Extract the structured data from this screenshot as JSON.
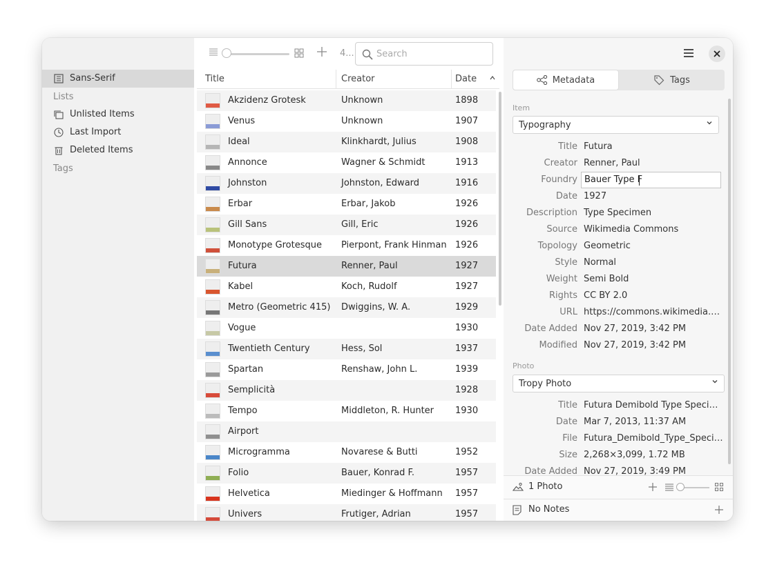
{
  "sidebar": {
    "project": "Sans-Serif",
    "lists_heading": "Lists",
    "items": [
      {
        "label": "Unlisted Items"
      },
      {
        "label": "Last Import"
      },
      {
        "label": "Deleted Items"
      }
    ],
    "tags_heading": "Tags"
  },
  "toolbar": {
    "count": "4...",
    "search_placeholder": "Search"
  },
  "table": {
    "headers": {
      "title": "Title",
      "creator": "Creator",
      "date": "Date"
    },
    "rows": [
      {
        "title": "Akzidenz Grotesk",
        "creator": "Unknown",
        "date": "1898",
        "color": "#e05a44"
      },
      {
        "title": "Venus",
        "creator": "Unknown",
        "date": "1907",
        "color": "#8a9bd6"
      },
      {
        "title": "Ideal",
        "creator": "Klinkhardt, Julius",
        "date": "1908",
        "color": "#b5b5b5"
      },
      {
        "title": "Annonce",
        "creator": "Wagner & Schmidt",
        "date": "1913",
        "color": "#888888"
      },
      {
        "title": "Johnston",
        "creator": "Johnston, Edward",
        "date": "1916",
        "color": "#2f4aa3"
      },
      {
        "title": "Erbar",
        "creator": "Erbar, Jakob",
        "date": "1926",
        "color": "#c98a4b"
      },
      {
        "title": "Gill Sans",
        "creator": "Gill, Eric",
        "date": "1926",
        "color": "#b9c27a"
      },
      {
        "title": "Monotype Grotesque",
        "creator": "Pierpont, Frank Hinman",
        "date": "1926",
        "color": "#d0503a"
      },
      {
        "title": "Futura",
        "creator": "Renner, Paul",
        "date": "1927",
        "color": "#c8b07a"
      },
      {
        "title": "Kabel",
        "creator": "Koch, Rudolf",
        "date": "1927",
        "color": "#d9562f"
      },
      {
        "title": "Metro (Geometric 415)",
        "creator": "Dwiggins, W. A.",
        "date": "1929",
        "color": "#777777"
      },
      {
        "title": "Vogue",
        "creator": "",
        "date": "1930",
        "color": "#c7c9a6"
      },
      {
        "title": "Twentieth Century",
        "creator": "Hess, Sol",
        "date": "1937",
        "color": "#5a8fcf"
      },
      {
        "title": "Spartan",
        "creator": "Renshaw, John L.",
        "date": "1939",
        "color": "#9a9a9a"
      },
      {
        "title": "Semplicità",
        "creator": "",
        "date": "1928",
        "color": "#d84b3a"
      },
      {
        "title": "Tempo",
        "creator": "Middleton, R. Hunter",
        "date": "1930",
        "color": "#bbbbbb"
      },
      {
        "title": "Airport",
        "creator": "",
        "date": "",
        "color": "#8f8f8f"
      },
      {
        "title": "Microgramma",
        "creator": "Novarese & Butti",
        "date": "1952",
        "color": "#4a86c8"
      },
      {
        "title": "Folio",
        "creator": "Bauer, Konrad F.",
        "date": "1957",
        "color": "#8fae54"
      },
      {
        "title": "Helvetica",
        "creator": "Miedinger & Hoffmann",
        "date": "1957",
        "color": "#d8341e"
      },
      {
        "title": "Univers",
        "creator": "Frutiger, Adrian",
        "date": "1957",
        "color": "#d44a3a"
      }
    ],
    "selected_index": 8
  },
  "panel": {
    "tabs": {
      "metadata": "Metadata",
      "tags": "Tags"
    },
    "item_label": "Item",
    "item_template": "Typography",
    "fields": [
      {
        "key": "Title",
        "value": "Futura"
      },
      {
        "key": "Creator",
        "value": "Renner, Paul"
      },
      {
        "key": "Foundry",
        "value": "Bauer Type F",
        "editing": true
      },
      {
        "key": "Date",
        "value": "1927"
      },
      {
        "key": "Description",
        "value": "Type Specimen"
      },
      {
        "key": "Source",
        "value": "Wikimedia Commons"
      },
      {
        "key": "Topology",
        "value": "Geometric"
      },
      {
        "key": "Style",
        "value": "Normal"
      },
      {
        "key": "Weight",
        "value": "Semi Bold"
      },
      {
        "key": "Rights",
        "value": "CC BY 2.0"
      },
      {
        "key": "URL",
        "value": "https://commons.wikimedia.org..."
      },
      {
        "key": "Date Added",
        "value": "Nov 27, 2019, 3:42 PM"
      },
      {
        "key": "Modified",
        "value": "Nov 27, 2019, 3:42 PM"
      }
    ],
    "photo_label": "Photo",
    "photo_template": "Tropy Photo",
    "photo_fields": [
      {
        "key": "Title",
        "value": "Futura Demibold Type Specimen"
      },
      {
        "key": "Date",
        "value": "Mar 7, 2013, 11:37 AM"
      },
      {
        "key": "File",
        "value": "Futura_Demibold_Type_Specim..."
      },
      {
        "key": "Size",
        "value": "2,268×3,099, 1.72 MB"
      },
      {
        "key": "Date Added",
        "value": "Nov 27, 2019, 3:49 PM"
      }
    ],
    "photos_count": "1 Photo",
    "notes": "No Notes"
  }
}
